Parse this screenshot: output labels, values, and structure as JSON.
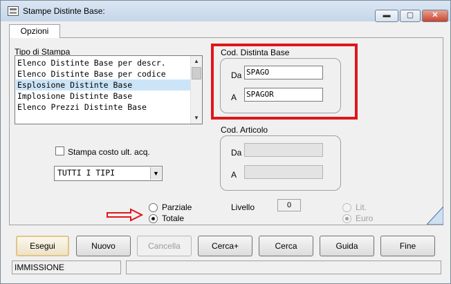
{
  "window": {
    "title": "Stampe Distinte Base:",
    "minimize": "▬",
    "maximize": "▢",
    "close": "✕"
  },
  "tabs": [
    "Opzioni"
  ],
  "tipo_stampa": {
    "label": "Tipo di Stampa",
    "items": [
      "Elenco Distinte Base per descr.",
      "Elenco Distinte Base per codice",
      "Esplosione Distinte Base",
      "Implosione Distinte Base",
      "Elenco Prezzi Distinte Base"
    ],
    "selected_index": 2
  },
  "cod_distinta_base": {
    "label": "Cod. Distinta Base",
    "da_label": "Da",
    "da_value": "SPAGO",
    "a_label": "A",
    "a_value": "SPAGOR"
  },
  "cod_articolo": {
    "label": "Cod. Articolo",
    "da_label": "Da",
    "da_value": "",
    "a_label": "A",
    "a_value": ""
  },
  "stampa_costo": {
    "label": "Stampa costo ult. acq.",
    "checked": false
  },
  "tipo_combo": {
    "value": "TUTTI I TIPI"
  },
  "modalita": {
    "parziale": "Parziale",
    "totale": "Totale",
    "selected": "Totale"
  },
  "livello": {
    "label": "Livello",
    "value": "0"
  },
  "valuta": {
    "lit": "Lit.",
    "euro": "Euro",
    "selected": "Euro"
  },
  "buttons": {
    "esegui": "Esegui",
    "nuovo": "Nuovo",
    "cancella": "Cancella",
    "cerca_plus": "Cerca+",
    "cerca": "Cerca",
    "guida": "Guida",
    "fine": "Fine"
  },
  "status": {
    "mode": "IMMISSIONE",
    "message": ""
  },
  "colors": {
    "highlight_box": "#e0161b",
    "annotation_arrow": "#e0161b",
    "list_selection": "#cce4f7"
  }
}
